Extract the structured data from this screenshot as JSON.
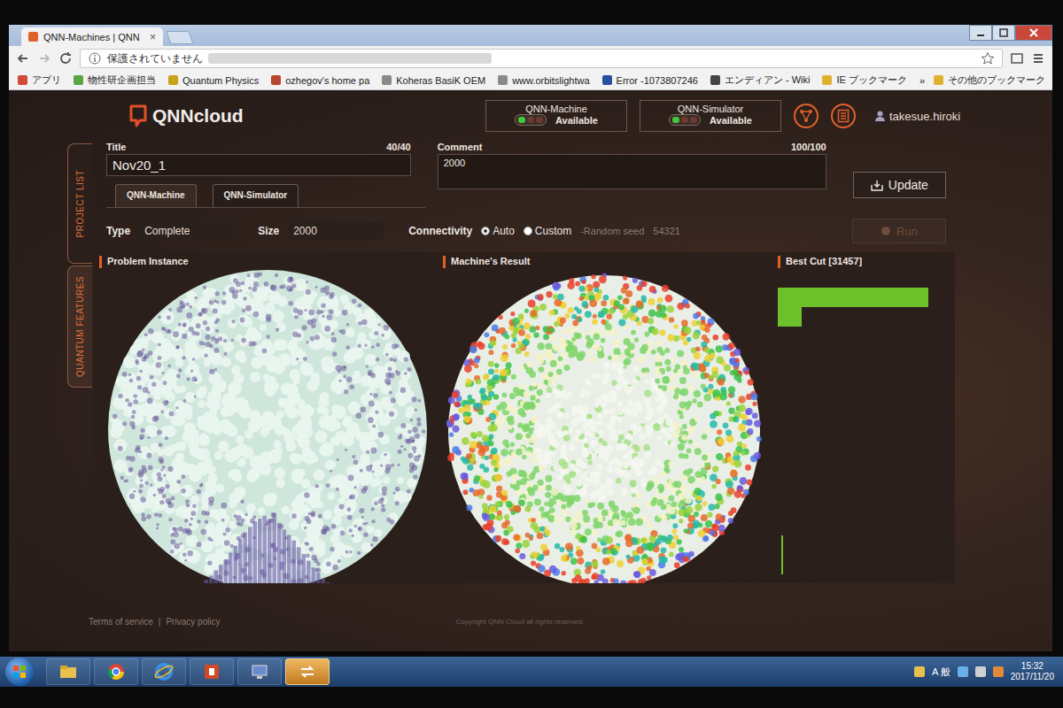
{
  "browser": {
    "tab": {
      "title": "QNN-Machines | QNN",
      "close": "×"
    },
    "address": {
      "security": "保護されていません"
    },
    "bookmarks": [
      {
        "label": "アプリ",
        "color": "#d24a3a"
      },
      {
        "label": "物性研企画担当",
        "color": "#5aa546"
      },
      {
        "label": "Quantum Physics",
        "color": "#c9a21c"
      },
      {
        "label": "ozhegov's home pa",
        "color": "#b8462e"
      },
      {
        "label": "Koheras BasiK OEM",
        "color": "#8a8a8a"
      },
      {
        "label": "www.orbitslightwa",
        "color": "#8a8a8a"
      },
      {
        "label": "Error -1073807246",
        "color": "#2a4fa0"
      },
      {
        "label": "エンディアン - Wiki",
        "color": "#444444"
      },
      {
        "label": "IE ブックマーク",
        "color": "#e0b030"
      }
    ],
    "overflow": "»",
    "other_bookmarks": "その他のブックマーク"
  },
  "app": {
    "logo": "QNNcloud",
    "statuses": [
      {
        "name": "QNN-Machine",
        "status": "Available",
        "lights": [
          true,
          false,
          false
        ]
      },
      {
        "name": "QNN-Simulator",
        "status": "Available",
        "lights": [
          true,
          false,
          false
        ]
      }
    ],
    "user": "takesue.hiroki",
    "side_tabs": [
      {
        "label": "PROJECT LIST",
        "selected": false
      },
      {
        "label": "QUANTUM FEATURES",
        "selected": true
      }
    ],
    "form": {
      "title": {
        "label": "Title",
        "counter": "40/40",
        "value": "Nov20_1"
      },
      "comment": {
        "label": "Comment",
        "counter": "100/100",
        "value": "2000"
      },
      "update": "Update"
    },
    "machine_tabs": [
      {
        "label": "QNN-Machine",
        "selected": true
      },
      {
        "label": "QNN-Simulator",
        "selected": false
      }
    ],
    "params": {
      "type": {
        "label": "Type",
        "value": "Complete"
      },
      "size": {
        "label": "Size",
        "value": "2000"
      },
      "connectivity": {
        "label": "Connectivity",
        "options": [
          {
            "label": "Auto",
            "selected": true
          },
          {
            "label": "Custom",
            "selected": false
          }
        ],
        "seed_label": "-Random seed",
        "seed": "54321"
      },
      "run": {
        "label": "Run",
        "disabled": true
      }
    },
    "panels": {
      "problem": {
        "title": "Problem Instance",
        "histogram": [
          2,
          3,
          4,
          5,
          6,
          8,
          10,
          13,
          16,
          20,
          24,
          28,
          33,
          38,
          43,
          48,
          52,
          56,
          58,
          60,
          58,
          62,
          55,
          50,
          46,
          42,
          37,
          32,
          27,
          22,
          18,
          14,
          11,
          9,
          7,
          5,
          4,
          3,
          2,
          2
        ]
      },
      "result": {
        "title": "Machine's Result"
      },
      "best_cut": {
        "title": "Best Cut [31457]",
        "bars": [
          1.0,
          0.16
        ]
      }
    },
    "footer": {
      "links": [
        "Terms of service",
        "Privacy policy"
      ],
      "separator": "|",
      "copyright": "Copyright QNN Cloud all rights reserved."
    }
  },
  "taskbar": {
    "apps": [
      {
        "kind": "folder",
        "active": false
      },
      {
        "kind": "chrome",
        "active": false
      },
      {
        "kind": "ie",
        "active": false
      },
      {
        "kind": "powerpoint",
        "active": false
      },
      {
        "kind": "monitor",
        "active": false
      },
      {
        "kind": "switch",
        "active": true
      }
    ],
    "ime": "A 般",
    "time": "15:32",
    "date": "2017/11/20"
  }
}
